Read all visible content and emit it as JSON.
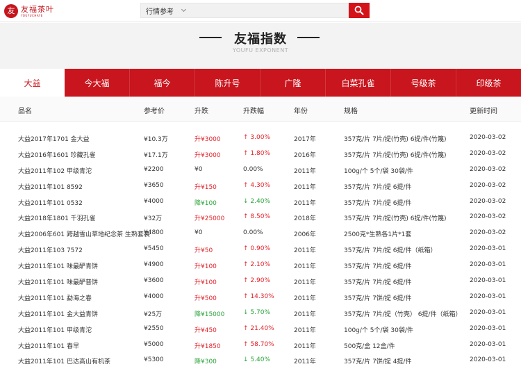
{
  "header": {
    "logo_mark": "友",
    "logo_cn": "友福茶叶",
    "logo_en": "YOUFUCHAYE",
    "search_category": "行情参考",
    "search_placeholder": ""
  },
  "banner": {
    "title": "友福指数",
    "subtitle": "YOUFU EXPONENT"
  },
  "tabs": [
    {
      "label": "大益",
      "active": true
    },
    {
      "label": "今大福",
      "active": false
    },
    {
      "label": "福今",
      "active": false
    },
    {
      "label": "陈升号",
      "active": false
    },
    {
      "label": "广隆",
      "active": false
    },
    {
      "label": "白菜孔雀",
      "active": false
    },
    {
      "label": "号级茶",
      "active": false
    },
    {
      "label": "印级茶",
      "active": false
    }
  ],
  "columns": {
    "name": "品名",
    "price": "参考价",
    "change": "升跌",
    "pct": "升跌幅",
    "year": "年份",
    "spec": "规格",
    "date": "更新时间"
  },
  "colors": {
    "brand_red": "#c9151d",
    "up": "#e0222a",
    "down": "#2aa33b"
  },
  "rows": [
    {
      "name": "大益2017年1701 金大益",
      "price": "¥10.3万",
      "change": "升¥3000",
      "pct": "↑ 3.00%",
      "trend": "up",
      "year": "2017年",
      "spec": "357克/片 7片/提(竹壳) 6提/件(竹篾)",
      "date": "2020-03-02"
    },
    {
      "name": "大益2016年1601 珍藏孔雀",
      "price": "¥17.1万",
      "change": "升¥3000",
      "pct": "↑ 1.80%",
      "trend": "up",
      "year": "2016年",
      "spec": "357克/片 7片/提(竹壳) 6提/件(竹篾)",
      "date": "2020-03-02"
    },
    {
      "name": "大益2011年102 甲级青沱",
      "price": "¥2200",
      "change": "¥0",
      "pct": "0.00%",
      "trend": "neutral",
      "year": "2011年",
      "spec": "100g/个 5个/袋 30袋/件",
      "date": "2020-03-02"
    },
    {
      "name": "大益2011年101 8592",
      "price": "¥3650",
      "change": "升¥150",
      "pct": "↑ 4.30%",
      "trend": "up",
      "year": "2011年",
      "spec": "357克/片 7片/提 6提/件",
      "date": "2020-03-02"
    },
    {
      "name": "大益2011年101 0532",
      "price": "¥4000",
      "change": "降¥100",
      "pct": "↓ 2.40%",
      "trend": "down",
      "year": "2011年",
      "spec": "357克/片 7片/提 6提/件",
      "date": "2020-03-02"
    },
    {
      "name": "大益2018年1801 千羽孔雀",
      "price": "¥32万",
      "change": "升¥25000",
      "pct": "↑ 8.50%",
      "trend": "up",
      "year": "2018年",
      "spec": "357克/片 7片/提(竹壳) 6提/件(竹篾)",
      "date": "2020-03-02"
    },
    {
      "name": "大益2006年601 跨越雪山草地纪念茶 生熟套装",
      "price": "¥4800",
      "change": "¥0",
      "pct": "0.00%",
      "trend": "neutral",
      "year": "2006年",
      "spec": "2500克*生熟各1片*1套",
      "date": "2020-03-02"
    },
    {
      "name": "大益2011年103 7572",
      "price": "¥5450",
      "change": "升¥50",
      "pct": "↑ 0.90%",
      "trend": "up",
      "year": "2011年",
      "spec": "357克/片 7片/提 6提/件（纸箱）",
      "date": "2020-03-01"
    },
    {
      "name": "大益2011年101 味最酽青饼",
      "price": "¥4900",
      "change": "升¥100",
      "pct": "↑ 2.10%",
      "trend": "up",
      "year": "2011年",
      "spec": "357克/片 7片/提 6提/件",
      "date": "2020-03-01"
    },
    {
      "name": "大益2011年101 味最酽普饼",
      "price": "¥3600",
      "change": "升¥100",
      "pct": "↑ 2.90%",
      "trend": "up",
      "year": "2011年",
      "spec": "357克/片 7片/提 6提/件",
      "date": "2020-03-01"
    },
    {
      "name": "大益2011年101 勐海之春",
      "price": "¥4000",
      "change": "升¥500",
      "pct": "↑ 14.30%",
      "trend": "up",
      "year": "2011年",
      "spec": "357克/片 7饼/提 6提/件",
      "date": "2020-03-01"
    },
    {
      "name": "大益2011年101 金大益青饼",
      "price": "¥25万",
      "change": "降¥15000",
      "pct": "↓ 5.70%",
      "trend": "down",
      "year": "2011年",
      "spec": "357克/片 7片/提（竹壳） 6提/件（纸箱）",
      "date": "2020-03-01"
    },
    {
      "name": "大益2011年101 甲级青沱",
      "price": "¥2550",
      "change": "升¥450",
      "pct": "↑ 21.40%",
      "trend": "up",
      "year": "2011年",
      "spec": "100g/个 5个/袋 30袋/件",
      "date": "2020-03-01"
    },
    {
      "name": "大益2011年101 春早",
      "price": "¥5000",
      "change": "升¥1850",
      "pct": "↑ 58.70%",
      "trend": "up",
      "year": "2011年",
      "spec": "500克/盒 12盒/件",
      "date": "2020-03-01"
    },
    {
      "name": "大益2011年101 巴达高山有机茶",
      "price": "¥5300",
      "change": "降¥300",
      "pct": "↓ 5.40%",
      "trend": "down",
      "year": "2011年",
      "spec": "357克/片 7饼/提 4提/件",
      "date": "2020-03-01"
    }
  ]
}
